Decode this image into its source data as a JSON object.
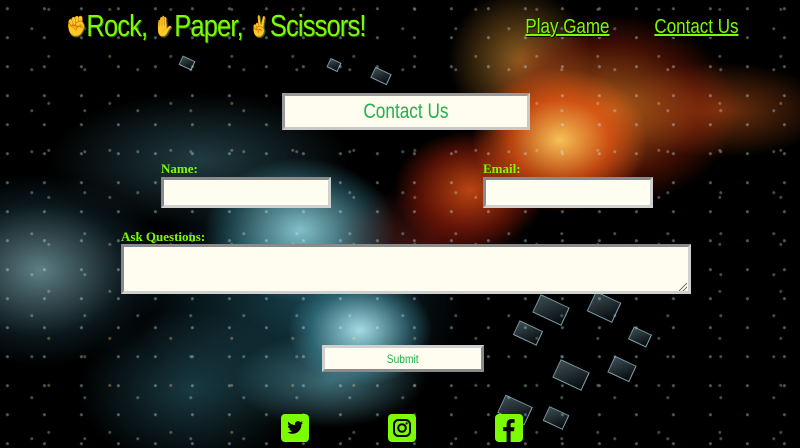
{
  "header": {
    "brand": {
      "words": [
        "Rock,",
        "Paper,",
        "Scissors!"
      ],
      "icons": [
        "rock-hand-icon",
        "paper-hand-icon",
        "scissors-hand-icon"
      ]
    },
    "nav": [
      {
        "label": "Play Game"
      },
      {
        "label": "Contact Us"
      }
    ]
  },
  "form": {
    "title": "Contact Us",
    "name_label": "Name:",
    "name_value": "",
    "email_label": "Email:",
    "email_value": "",
    "questions_label": "Ask Questions:",
    "questions_value": "",
    "submit_label": "Submit"
  },
  "social": [
    {
      "icon": "twitter-icon"
    },
    {
      "icon": "instagram-icon"
    },
    {
      "icon": "facebook-icon"
    }
  ],
  "colors": {
    "accent": "#7cfc00",
    "title_text": "#22b14c",
    "field_background": "#fffdf0",
    "page_background": "#000000"
  }
}
